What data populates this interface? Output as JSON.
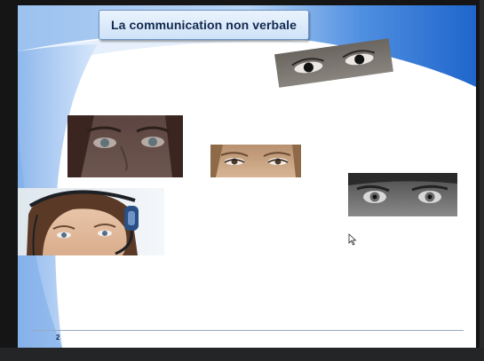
{
  "slide": {
    "title": "La communication non verbale",
    "page_number": "2"
  },
  "images": [
    {
      "name": "dark-skin-eyes-image",
      "description": "eyes"
    },
    {
      "name": "woman-eyes-image",
      "description": "eyes"
    },
    {
      "name": "blonde-eyes-image",
      "description": "eyes"
    },
    {
      "name": "bw-eyes-image",
      "description": "eyes"
    },
    {
      "name": "headset-woman-image",
      "description": "woman with headset"
    }
  ],
  "colors": {
    "theme_blue": "#2f77d3",
    "light_blue": "#a9c9f1",
    "title_text": "#12294f",
    "footer_line": "#9aa9c4"
  }
}
